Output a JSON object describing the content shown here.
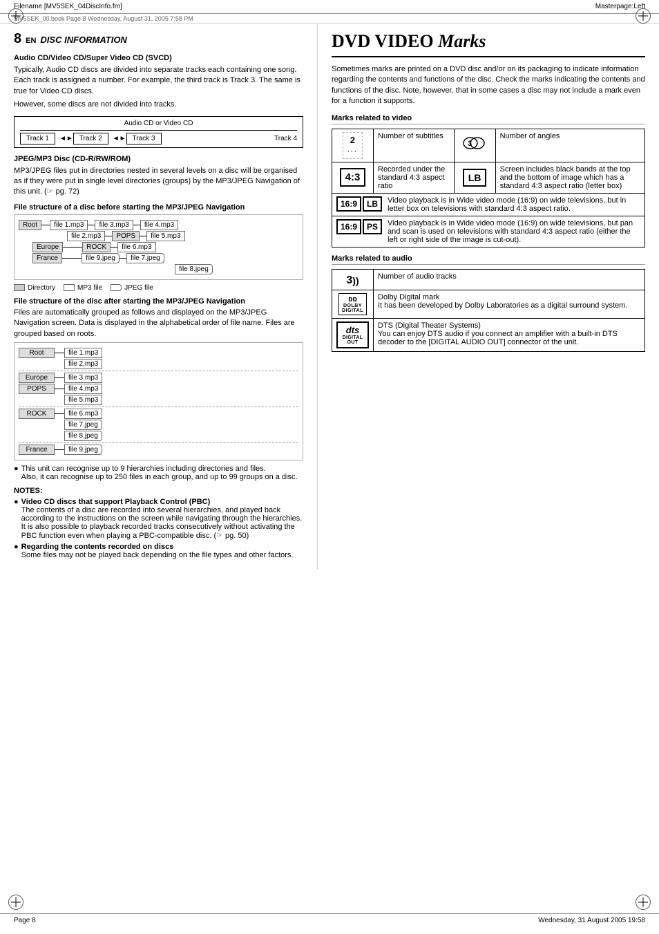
{
  "header": {
    "filename": "Filename [MV5SEK_04DiscInfo.fm]",
    "subline": "MV5SEK_00.book  Page 8  Wednesday, August 31, 2005  7:58 PM",
    "masterpage": "Masterpage:Left"
  },
  "section": {
    "number": "8",
    "lang": "EN",
    "title": "DISC INFORMATION"
  },
  "audio_cd": {
    "title": "Audio CD/Video CD/Super Video CD (SVCD)",
    "para1": "Typically, Audio CD discs are divided into separate tracks each containing one song. Each track is assigned a number. For example, the third track is Track 3. The same is true for Video CD discs.",
    "para2": "However, some discs are not divided into tracks.",
    "track_label": "Audio CD or Video CD",
    "tracks": [
      "Track 1",
      "Track 2",
      "Track 3",
      "Track 4"
    ]
  },
  "jpeg_mp3": {
    "title": "JPEG/MP3 Disc (CD-R/RW/ROM)",
    "para": "MP3/JPEG files put in directories nested in several levels on a disc will be organised as if they were put in single level directories (groups) by the MP3/JPEG Navigation of this unit. (☞ pg. 72)",
    "fs_title": "File structure of a disc before starting the MP3/JPEG Navigation",
    "nodes_before": {
      "root": "Root",
      "files": [
        "file 1.mp3",
        "file 2.mp3",
        "file 3.mp3",
        "file 4.mp3",
        "file 5.mp3",
        "file 6.mp3",
        "file 7.jpeg",
        "file 8.jpeg",
        "file 9.jpeg"
      ],
      "dirs": [
        "POPS",
        "ROCK",
        "Europe",
        "France"
      ]
    },
    "legend": {
      "directory": "Directory",
      "mp3": "MP3 file",
      "jpeg": "JPEG file"
    },
    "fs_after_title": "File structure of the disc after starting the MP3/JPEG Navigation",
    "fs_after_para": "Files are automatically grouped as follows and displayed on the MP3/JPEG Navigation screen. Data is displayed in the alphabetical order of file name. Files are grouped based on roots.",
    "bullet1": "This unit can recognise up to 9 hierarchies including directories and files.\nAlso, it can recognise up to 250 files in each group, and up to 99 groups on a disc.",
    "notes_title": "NOTES:",
    "note1_title": "Video CD discs that support Playback Control (PBC)",
    "note1_text": "The contents of a disc are recorded into several hierarchies, and played back according to the instructions on the screen while navigating through the hierarchies. It is also possible to playback recorded tracks consecutively without activating the PBC function even when playing a PBC-compatible disc. (☞ pg. 50)",
    "note2_title": "Regarding the contents recorded on discs",
    "note2_text": "Some files may not be played back depending on the file types and other factors."
  },
  "dvd_marks": {
    "title": "DVD VIDEO Marks",
    "intro": "Sometimes marks are printed on a DVD disc and/or on its packaging to indicate information regarding the contents and functions of the disc. Check the marks indicating the contents and functions of the disc. Note, however, that in some cases a disc may not include a mark even for a function it supports.",
    "video_section": "Marks related to video",
    "marks_video": [
      {
        "icon": "2\n···",
        "desc": "Number of subtitles",
        "icon2": "∞\n3",
        "desc2": "Number of angles"
      },
      {
        "icon": "4:3",
        "desc": "Recorded under the standard 4:3 aspect ratio",
        "icon2": "LB",
        "desc2": "Screen includes black bands at the top and the bottom of image which has a standard 4:3 aspect ratio (letter box)"
      },
      {
        "icon_full": "16:9 LB",
        "desc": "Video playback is in Wide video mode (16:9) on wide televisions, but in letter box on televisions with standard 4:3 aspect ratio."
      },
      {
        "icon_full": "16:9 PS",
        "desc": "Video playback is in Wide video mode (16:9) on wide televisions, but pan and scan is used on televisions with standard 4:3 aspect ratio (either the left or right side of the image is cut-out)."
      }
    ],
    "audio_section": "Marks related to audio",
    "marks_audio": [
      {
        "icon": "3))",
        "desc": "Number of audio tracks"
      },
      {
        "icon": "DD DOLBY DIGITAL",
        "desc": "Dolby Digital mark\nIt has been developed by Dolby Laboratories as a digital surround system."
      },
      {
        "icon": "dts DIGITAL OUT",
        "desc": "DTS (Digital Theater Systems)\nYou can enjoy DTS audio if you connect an amplifier with a built-in DTS decoder to the [DIGITAL AUDIO OUT] connector of the unit."
      }
    ]
  },
  "footer": {
    "page": "Page 8",
    "date": "Wednesday, 31 August 2005  19:58"
  }
}
